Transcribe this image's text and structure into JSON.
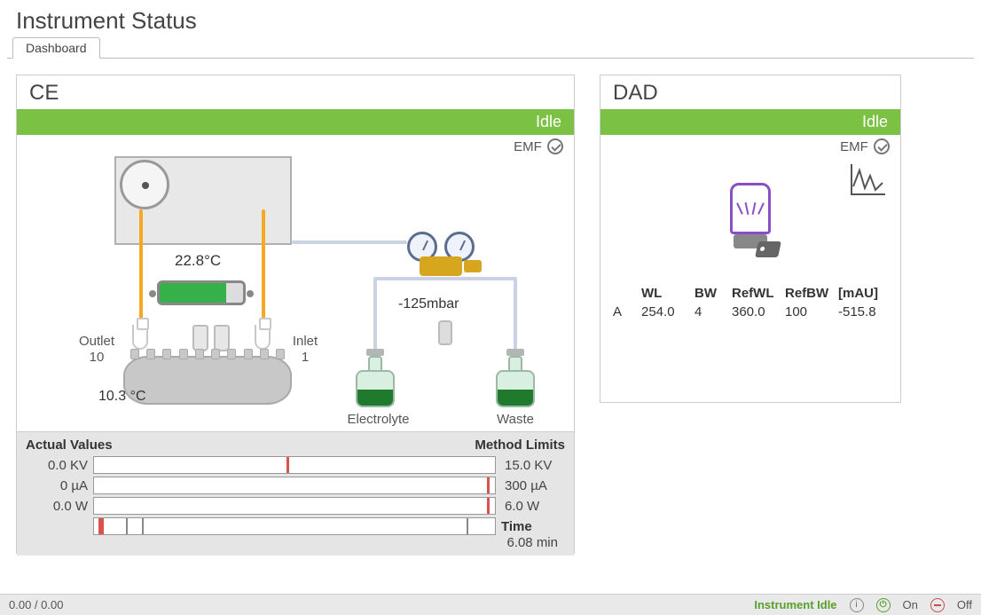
{
  "page": {
    "title": "Instrument Status"
  },
  "tabs": [
    {
      "label": "Dashboard"
    }
  ],
  "ce": {
    "title": "CE",
    "status": "Idle",
    "emf_label": "EMF",
    "temp_detector": "22.8°C",
    "pressure": "-125mbar",
    "outlet_label": "Outlet",
    "outlet_pos": "10",
    "inlet_label": "Inlet",
    "inlet_pos": "1",
    "tray_temp": "10.3 °C",
    "electrolyte_label": "Electrolyte",
    "waste_label": "Waste",
    "actual_header": "Actual Values",
    "limits_header": "Method Limits",
    "rows": [
      {
        "value": "0.0 KV",
        "limit": "15.0 KV",
        "mark_pct": 48
      },
      {
        "value": "0 µA",
        "limit": "300 µA",
        "mark_pct": 98
      },
      {
        "value": "0.0 W",
        "limit": "6.0 W",
        "mark_pct": 98
      }
    ],
    "time_label": "Time",
    "time_value": "6.08 min"
  },
  "dad": {
    "title": "DAD",
    "status": "Idle",
    "emf_label": "EMF",
    "headers": {
      "ch": "",
      "wl": "WL",
      "bw": "BW",
      "refwl": "RefWL",
      "refbw": "RefBW",
      "mau": "[mAU]"
    },
    "rows": [
      {
        "ch": "A",
        "wl": "254.0",
        "bw": "4",
        "refwl": "360.0",
        "refbw": "100",
        "mau": "-515.8"
      }
    ]
  },
  "statusbar": {
    "progress": "0.00 / 0.00",
    "instrument_state": "Instrument Idle",
    "on_label": "On",
    "off_label": "Off"
  }
}
